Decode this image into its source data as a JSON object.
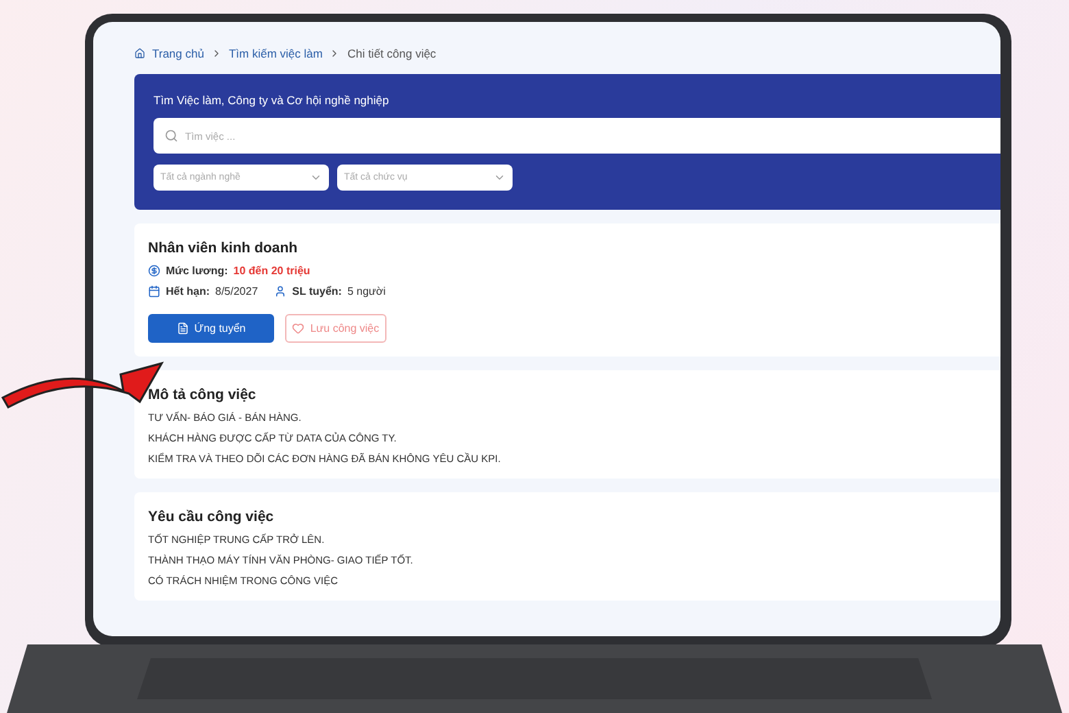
{
  "breadcrumb": [
    {
      "label": "Trang chủ",
      "kind": "home"
    },
    {
      "label": "Tìm kiếm việc làm",
      "kind": "link"
    },
    {
      "label": "Chi tiết công việc",
      "kind": "current"
    }
  ],
  "search_panel": {
    "title": "Tìm Việc làm, Công ty và Cơ hội nghề nghiệp",
    "search": {
      "placeholder": "Tìm việc ..."
    },
    "filters": [
      {
        "placeholder": "Tất cả ngành nghề"
      },
      {
        "placeholder": "Tất cả chức vụ"
      }
    ]
  },
  "job": {
    "title": "Nhân viên kinh doanh",
    "salary_label": "Mức lương:",
    "salary": "10 đến 20 triệu",
    "deadline_label": "Hết hạn:",
    "deadline": "8/5/2027",
    "headcount_label": "SL tuyển:",
    "headcount": "5 người",
    "buttons": [
      {
        "label": "Ứng tuyển",
        "kind": "primary"
      },
      {
        "label": "Lưu công việc",
        "kind": "outline"
      }
    ]
  },
  "sections": [
    {
      "title": "Mô tả công việc",
      "lines": [
        "TƯ VẤN- BÁO GIÁ - BÁN HÀNG.",
        "KHÁCH HÀNG ĐƯỢC CẤP TỪ DATA CỦA CÔNG TY.",
        "KIỂM TRA VÀ THEO DÕI CÁC ĐƠN HÀNG ĐÃ BÁN KHÔNG YÊU CẦU KPI."
      ]
    },
    {
      "title": "Yêu cầu công việc",
      "lines": [
        "TỐT NGHIỆP TRUNG CẤP TRỞ LÊN.",
        "THÀNH THẠO MÁY TÍNH VĂN PHÒNG- GIAO TIẾP TỐT.",
        "CÓ TRÁCH NHIỆM TRONG CÔNG VIỆC"
      ]
    }
  ]
}
